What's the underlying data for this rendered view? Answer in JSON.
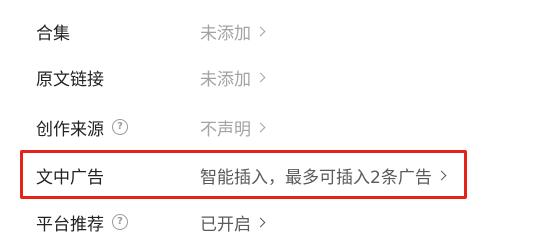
{
  "settings": {
    "rows": [
      {
        "label": "合集",
        "value": "未添加"
      },
      {
        "label": "原文链接",
        "value": "未添加"
      },
      {
        "label": "创作来源",
        "help_icon": "help-circle-icon",
        "value": "不声明"
      },
      {
        "label": "文中广告",
        "value": "智能插入，最多可插入2条广告",
        "highlighted": true
      },
      {
        "label": "平台推荐",
        "help_icon": "help-circle-icon",
        "value": "已开启"
      }
    ]
  },
  "help_glyph": "?",
  "colors": {
    "label": "#222222",
    "value_muted": "#a3a3a3",
    "value_strong": "#5a5a5a",
    "highlight_border": "#e5221b"
  }
}
